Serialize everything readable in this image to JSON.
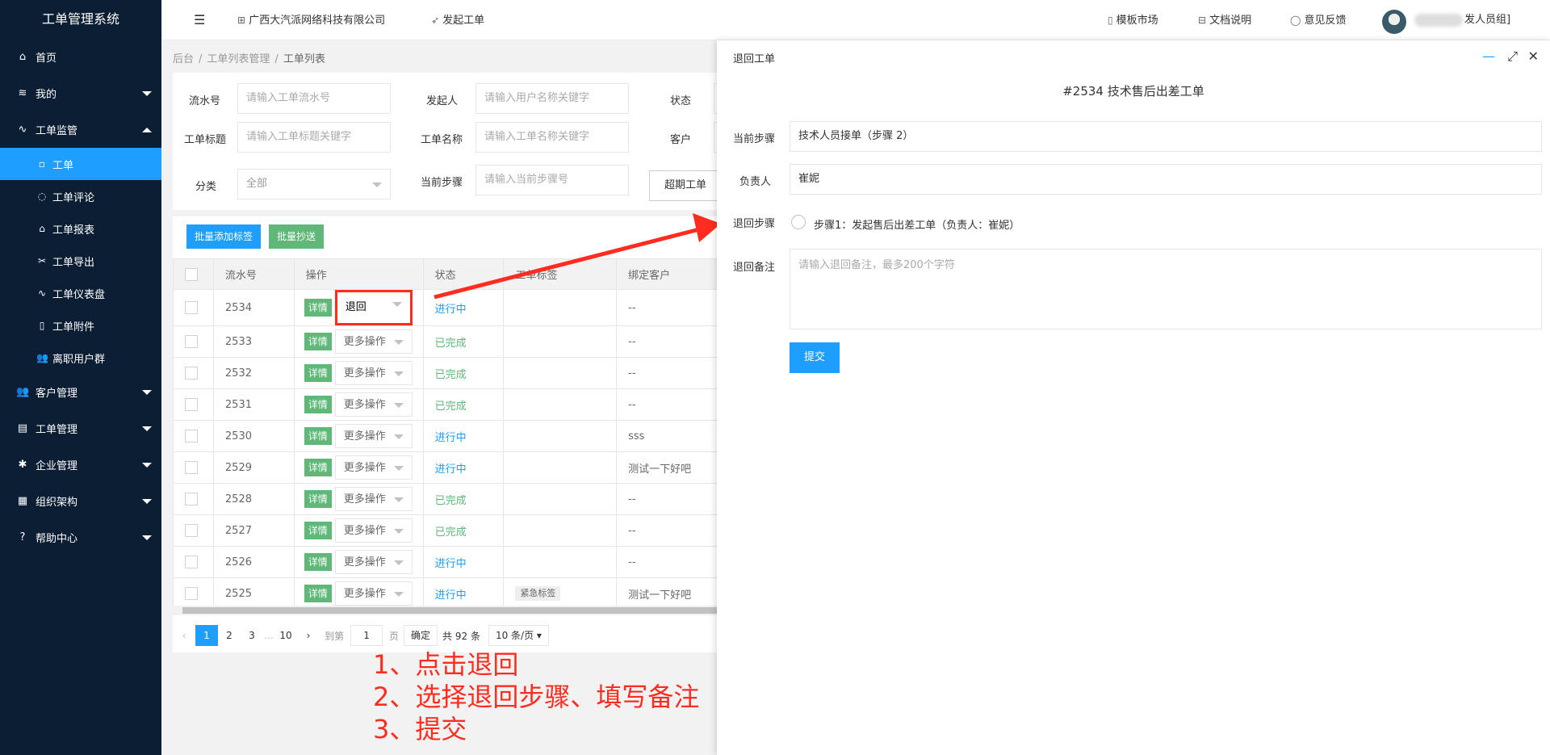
{
  "app": {
    "title": "工单管理系统"
  },
  "sidebar": {
    "items": [
      {
        "label": "首页",
        "icon": "home-icon"
      },
      {
        "label": "我的",
        "icon": "layers-icon"
      },
      {
        "label": "工单监管",
        "icon": "pulse-icon"
      },
      {
        "label": "客户管理",
        "icon": "users-icon"
      },
      {
        "label": "工单管理",
        "icon": "doc-icon"
      },
      {
        "label": "企业管理",
        "icon": "gear-icon"
      },
      {
        "label": "组织架构",
        "icon": "tree-icon"
      },
      {
        "label": "帮助中心",
        "icon": "question-icon"
      }
    ],
    "subitems": [
      {
        "label": "工单",
        "active": true
      },
      {
        "label": "工单评论"
      },
      {
        "label": "工单报表"
      },
      {
        "label": "工单导出"
      },
      {
        "label": "工单仪表盘"
      },
      {
        "label": "工单附件"
      },
      {
        "label": "离职用户群"
      }
    ]
  },
  "header": {
    "company": "广西大汽派网络科技有限公司",
    "new_ticket": "发起工单",
    "template_market": "模板市场",
    "docs": "文档说明",
    "feedback": "意见反馈",
    "user_group": "发人员组]"
  },
  "breadcrumb": {
    "root": "后台",
    "mid": "工单列表管理",
    "current": "工单列表"
  },
  "filters": {
    "serial_label": "流水号",
    "serial_placeholder": "请输入工单流水号",
    "initiator_label": "发起人",
    "initiator_placeholder": "请输入用户名称关键字",
    "status_label": "状态",
    "title_label": "工单标题",
    "title_placeholder": "请输入工单标题关键字",
    "name_label": "工单名称",
    "name_placeholder": "请输入工单名称关键字",
    "customer_label": "客户",
    "category_label": "分类",
    "category_value": "全部",
    "step_label": "当前步骤",
    "step_placeholder": "请输入当前步骤号",
    "overdue_button": "超期工单"
  },
  "toolbar": {
    "batch_tag": "批量添加标签",
    "batch_cc": "批量抄送"
  },
  "table": {
    "columns": [
      "流水号",
      "操作",
      "状态",
      "工单标签",
      "绑定客户"
    ],
    "detail_label": "详情",
    "more_ops": "更多操作",
    "rows": [
      {
        "id": "2534",
        "op": "退回",
        "status": "进行中",
        "tag": "",
        "customer": "--"
      },
      {
        "id": "2533",
        "op": "更多操作",
        "status": "已完成",
        "tag": "",
        "customer": "--"
      },
      {
        "id": "2532",
        "op": "更多操作",
        "status": "已完成",
        "tag": "",
        "customer": "--"
      },
      {
        "id": "2531",
        "op": "更多操作",
        "status": "已完成",
        "tag": "",
        "customer": "--"
      },
      {
        "id": "2530",
        "op": "更多操作",
        "status": "进行中",
        "tag": "",
        "customer": "sss"
      },
      {
        "id": "2529",
        "op": "更多操作",
        "status": "进行中",
        "tag": "",
        "customer": "测试一下好吧"
      },
      {
        "id": "2528",
        "op": "更多操作",
        "status": "已完成",
        "tag": "",
        "customer": "--"
      },
      {
        "id": "2527",
        "op": "更多操作",
        "status": "已完成",
        "tag": "",
        "customer": "--"
      },
      {
        "id": "2526",
        "op": "更多操作",
        "status": "进行中",
        "tag": "",
        "customer": "--"
      },
      {
        "id": "2525",
        "op": "更多操作",
        "status": "进行中",
        "tag": "紧急标签",
        "customer": "测试一下好吧"
      }
    ]
  },
  "pager": {
    "pages": [
      "1",
      "2",
      "3",
      "…",
      "10"
    ],
    "goto_label": "到第",
    "goto_value": "1",
    "page_unit": "页",
    "confirm": "确定",
    "total": "共 92 条",
    "page_size": "10 条/页"
  },
  "notes": [
    "1、点击退回",
    "2、选择退回步骤、填写备注",
    "3、提交"
  ],
  "panel": {
    "title": "退回工单",
    "ticket_title": "#2534 技术售后出差工单",
    "current_step_label": "当前步骤",
    "current_step_value": "技术人员接单（步骤 2）",
    "assignee_label": "负责人",
    "assignee_value": "崔妮",
    "return_step_label": "退回步骤",
    "return_step_option": "步骤1：发起售后出差工单（负责人：崔妮）",
    "remark_label": "退回备注",
    "remark_placeholder": "请输入退回备注，最多200个字符",
    "submit": "提交"
  },
  "colors": {
    "sidebar_bg": "#0b1e33",
    "primary": "#1e9fff",
    "success": "#5fb878",
    "annotation": "#ff2d20"
  }
}
